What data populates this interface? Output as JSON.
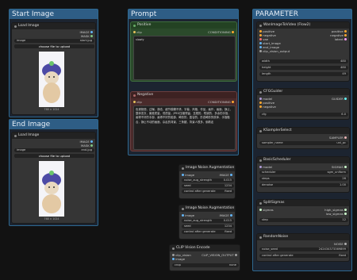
{
  "groups": {
    "start": "Start Image",
    "end": "End Image",
    "prompt": "Prompt",
    "parameter": "PARAMETER"
  },
  "load_start": {
    "title": "Load Image",
    "out1": "IMAGE",
    "out2": "MASK",
    "image_label": "image",
    "image_value": "start.jpg",
    "upload": "choose file to upload",
    "caption": "768 × 1024"
  },
  "load_end": {
    "title": "Load Image",
    "out1": "IMAGE",
    "out2": "MASK",
    "image_label": "image",
    "image_value": "end.jpg",
    "upload": "choose file to upload",
    "caption": "768 × 1024"
  },
  "positive": {
    "title": "Positive",
    "in": "clip",
    "out": "CONDITIONING",
    "text": "slowly"
  },
  "negative": {
    "title": "Negative",
    "in": "clip",
    "out": "CONDITIONING",
    "text": "色调艳丽，过曝，静态，细节模糊不清，字幕，风格，作品，画作，画面，静止，整体发灰，最差质量，低质量，JPEG压缩残留，丑陋的，残缺的，多余的手指，画得不好的手部，画得不好的脸部，畸形的，毁容的，形态畸形的肢体，手指融合，静止不动的画面，杂乱的背景，三条腿，背景人很多，倒着走"
  },
  "wan": {
    "title": "WanImageToVideo (Flow2)",
    "inputs": [
      "positive",
      "negative",
      "vae",
      "start_image",
      "end_image",
      "clip_vision_output"
    ],
    "outputs": [
      "positive",
      "negative",
      "latent"
    ],
    "widgets": [
      {
        "label": "width",
        "value": "480"
      },
      {
        "label": "height",
        "value": "480"
      },
      {
        "label": "length",
        "value": "49"
      }
    ]
  },
  "cfg": {
    "title": "CFGGuider",
    "inputs": [
      "model",
      "positive",
      "negative"
    ],
    "output": "GUIDER",
    "widget_label": "cfg",
    "widget_value": "6.0"
  },
  "ksampler": {
    "title": "KSamplerSelect",
    "output": "SAMPLER",
    "widget_label": "sampler_name",
    "widget_value": "uni_pc"
  },
  "basic": {
    "title": "BasicScheduler",
    "input": "model",
    "output": "SIGMAS",
    "widgets": [
      {
        "label": "scheduler",
        "value": "sgm_uniform"
      },
      {
        "label": "steps",
        "value": "26"
      },
      {
        "label": "denoise",
        "value": "1.00"
      }
    ]
  },
  "split": {
    "title": "SplitSigmas",
    "input": "sigmas",
    "outputs": [
      "high_sigmas",
      "low_sigmas"
    ],
    "widget_label": "step",
    "widget_value": "12"
  },
  "random": {
    "title": "RandomNoise",
    "output": "NOISE",
    "widgets": [
      {
        "label": "noise_seed",
        "value": "242434373369899"
      },
      {
        "label": "control after generate",
        "value": "fixed"
      }
    ]
  },
  "aug1": {
    "title": "Image Noise Augmentation",
    "in": "image",
    "out": "IMAGE",
    "widgets": [
      {
        "label": "noise_aug_strength",
        "value": "0.015"
      },
      {
        "label": "seed",
        "value": "1234"
      },
      {
        "label": "control after generate",
        "value": "fixed"
      }
    ]
  },
  "aug2": {
    "title": "Image Noise Augmentation",
    "in": "image",
    "out": "IMAGE",
    "widgets": [
      {
        "label": "noise_aug_strength",
        "value": "0.015"
      },
      {
        "label": "seed",
        "value": "1234"
      },
      {
        "label": "control after generate",
        "value": "fixed"
      }
    ]
  },
  "clipvision": {
    "title": "CLIP Vision Encode",
    "inputs": [
      "clip_vision",
      "image"
    ],
    "output": "CLIP_VISION_OUTPUT",
    "widget_label": "crop",
    "widget_value": "none"
  },
  "colors": {
    "group_title": "#2e5d85",
    "node_bg": "#353535",
    "positive": "#2b4a2b",
    "negative": "#4a2b2b"
  }
}
